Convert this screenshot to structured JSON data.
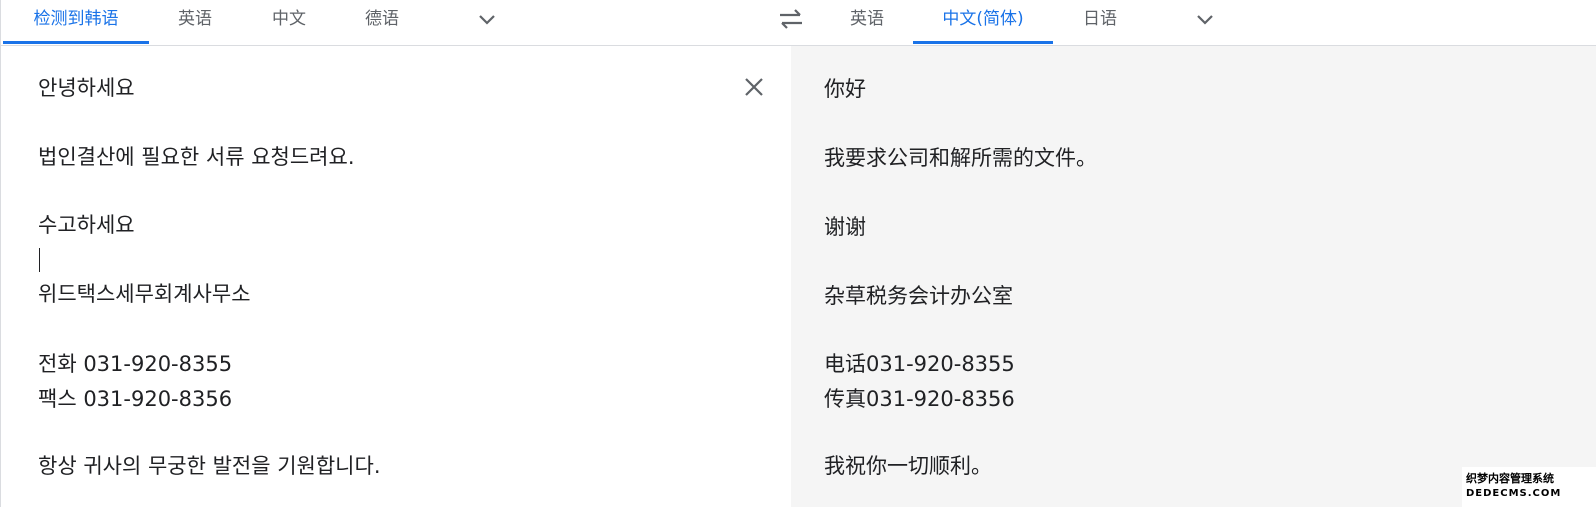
{
  "source_tabs": [
    {
      "label": "检测到韩语",
      "active": true
    },
    {
      "label": "英语",
      "active": false
    },
    {
      "label": "中文",
      "active": false
    },
    {
      "label": "德语",
      "active": false
    }
  ],
  "target_tabs": [
    {
      "label": "英语",
      "active": false
    },
    {
      "label": "中文(简体)",
      "active": true
    },
    {
      "label": "日语",
      "active": false
    }
  ],
  "icons": {
    "more_source": "chevron-down-icon",
    "swap": "swap-arrows-icon",
    "more_target": "chevron-down-icon",
    "clear": "close-icon"
  },
  "colors": {
    "accent": "#1a73e8",
    "tab_text": "#5f6368",
    "text": "#202124",
    "target_bg": "#f5f5f5",
    "divider": "#dadce0"
  },
  "source_text": [
    "안녕하세요",
    "법인결산에 필요한 서류 요청드려요.",
    "수고하세요",
    "위드택스세무회계사무소",
    "전화 031-920-8355",
    "팩스 031-920-8356",
    "항상 귀사의 무궁한 발전을 기원합니다."
  ],
  "target_text": [
    "你好",
    "我要求公司和解所需的文件。",
    "谢谢",
    "杂草税务会计办公室",
    "电话031-920-8355",
    "传真031-920-8356",
    "我祝你一切顺利。"
  ],
  "watermark": {
    "line1": "织梦内容管理系统",
    "line2": "DEDECMS.COM"
  }
}
